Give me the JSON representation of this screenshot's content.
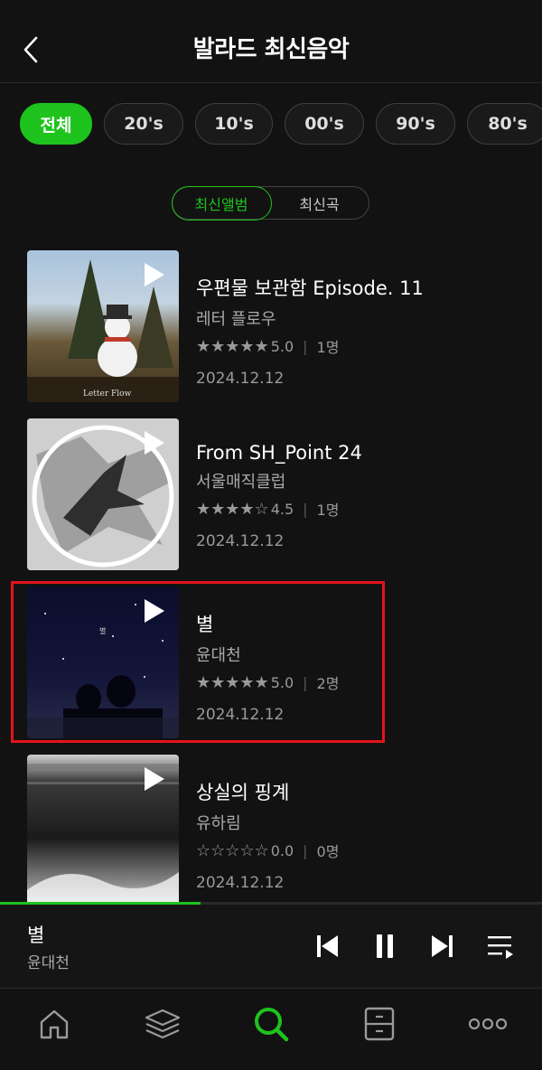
{
  "header": {
    "title": "발라드 최신음악"
  },
  "filters": {
    "chips": [
      {
        "label": "전체",
        "active": true
      },
      {
        "label": "20's",
        "active": false
      },
      {
        "label": "10's",
        "active": false
      },
      {
        "label": "00's",
        "active": false
      },
      {
        "label": "90's",
        "active": false
      },
      {
        "label": "80's",
        "active": false
      }
    ],
    "toggle": [
      {
        "label": "최신앨범",
        "active": true
      },
      {
        "label": "최신곡",
        "active": false
      }
    ]
  },
  "albums": [
    {
      "title": "우편물 보관함 Episode. 11",
      "artist": "레터 플로우",
      "stars": "★★★★★",
      "score": "5.0",
      "raters": "1명",
      "date": "2024.12.12",
      "cover_text": "Letter Flow"
    },
    {
      "title": "From SH_Point 24",
      "artist": "서울매직클럽",
      "stars": "★★★★☆",
      "score": "4.5",
      "raters": "1명",
      "date": "2024.12.12"
    },
    {
      "title": "별",
      "artist": "윤대천",
      "stars": "★★★★★",
      "score": "5.0",
      "raters": "2명",
      "date": "2024.12.12",
      "cover_text": "별"
    },
    {
      "title": "상실의 핑계",
      "artist": "유하림",
      "stars": "☆☆☆☆☆",
      "score": "0.0",
      "raters": "0명",
      "date": "2024.12.12"
    }
  ],
  "now_playing": {
    "title": "별",
    "artist": "윤대천",
    "progress": 0.37
  },
  "tabs": [
    "home-icon",
    "layers-icon",
    "search-icon",
    "storage-icon",
    "more-icon"
  ],
  "colors": {
    "accent": "#1ec31e",
    "highlight": "#e3141a",
    "background": "#121212"
  }
}
